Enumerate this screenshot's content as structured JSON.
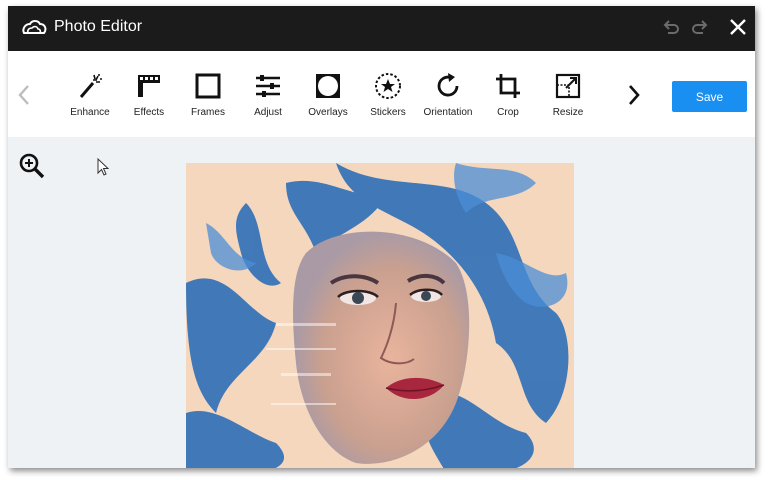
{
  "window": {
    "title": "Photo Editor",
    "icons": [
      "creative-cloud-logo",
      "undo-icon",
      "redo-icon",
      "close-icon"
    ]
  },
  "toolbar": {
    "tools": [
      {
        "label": "Enhance",
        "icon": "magic-wand-icon"
      },
      {
        "label": "Effects",
        "icon": "film-icon"
      },
      {
        "label": "Frames",
        "icon": "frame-icon"
      },
      {
        "label": "Adjust",
        "icon": "sliders-icon"
      },
      {
        "label": "Overlays",
        "icon": "overlay-icon"
      },
      {
        "label": "Stickers",
        "icon": "star-sticker-icon"
      },
      {
        "label": "Orientation",
        "icon": "rotate-icon"
      },
      {
        "label": "Crop",
        "icon": "crop-icon"
      },
      {
        "label": "Resize",
        "icon": "resize-icon"
      }
    ],
    "save_label": "Save"
  },
  "colors": {
    "titlebar": "#1b1b1b",
    "accent": "#1a8ff2",
    "canvas": "#eef2f4",
    "photo_background": "#f5d7bd",
    "photo_paint": "#2e6fb8"
  }
}
